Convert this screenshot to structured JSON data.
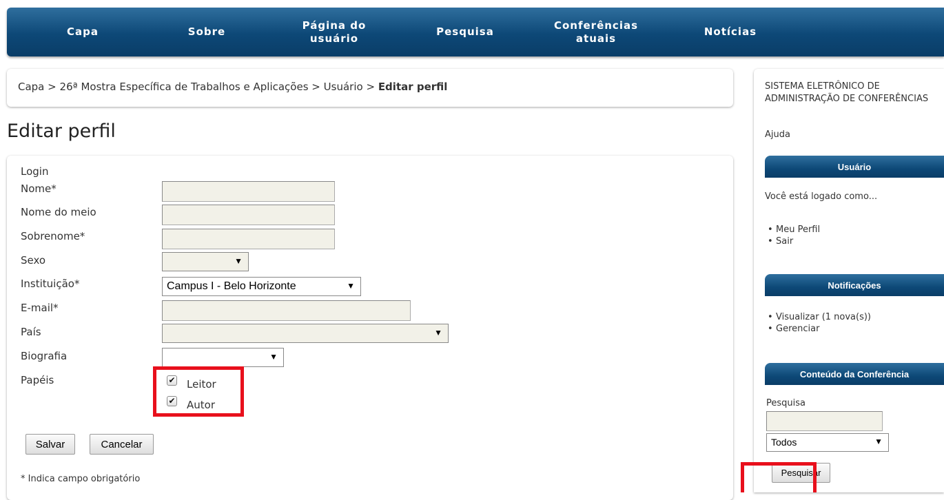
{
  "nav": {
    "items": [
      {
        "label": "Capa"
      },
      {
        "label": "Sobre"
      },
      {
        "label": "Página do usuário",
        "line1": "Página do",
        "line2": "usuário"
      },
      {
        "label": "Pesquisa"
      },
      {
        "label": "Conferências atuais",
        "line1": "Conferências",
        "line2": "atuais"
      },
      {
        "label": "Notícias"
      }
    ]
  },
  "breadcrumb": {
    "items": [
      "Capa",
      "26ª Mostra Específica de Trabalhos e Aplicações",
      "Usuário"
    ],
    "separator": ">",
    "current": "Editar perfil"
  },
  "page_title": "Editar perfil",
  "form": {
    "login_label": "Login",
    "name_label": "Nome*",
    "name_value": "",
    "middle_name_label": "Nome do meio",
    "middle_name_value": "",
    "last_name_label": "Sobrenome*",
    "last_name_value": "",
    "gender_label": "Sexo",
    "gender_value": "",
    "institution_label": "Instituição*",
    "institution_value": "Campus I - Belo Horizonte",
    "email_label": "E-mail*",
    "email_value": "",
    "country_label": "País",
    "country_value": "",
    "biography_label": "Biografia",
    "biography_value": "",
    "roles_label": "Papéis",
    "roles": [
      {
        "label": "Leitor",
        "checked": true
      },
      {
        "label": "Autor",
        "checked": true
      }
    ],
    "dropdown_arrow": "▼",
    "checkmark": "✔",
    "save_label": "Salvar",
    "cancel_label": "Cancelar",
    "required_note": "* Indica campo obrigatório"
  },
  "sidebar": {
    "system_title_line1": "SISTEMA ELETRÔNICO DE",
    "system_title_line2": "ADMINISTRAÇÃO DE CONFERÊNCIAS",
    "help_label": "Ajuda",
    "user_block": {
      "title": "Usuário",
      "logged_as": "Você está logado como...",
      "links": [
        "Meu Perfil",
        "Sair"
      ]
    },
    "notifications_block": {
      "title": "Notificações",
      "links": [
        "Visualizar (1 nova(s))",
        "Gerenciar"
      ]
    },
    "content_block": {
      "title": "Conteúdo da Conferência",
      "search_label": "Pesquisa",
      "search_value": "",
      "scope_value": "Todos",
      "search_button": "Pesquisar"
    }
  },
  "colors": {
    "nav_bg": "#0d4877",
    "highlight_box": "#e8101c",
    "input_bg": "#f2f1e8"
  }
}
